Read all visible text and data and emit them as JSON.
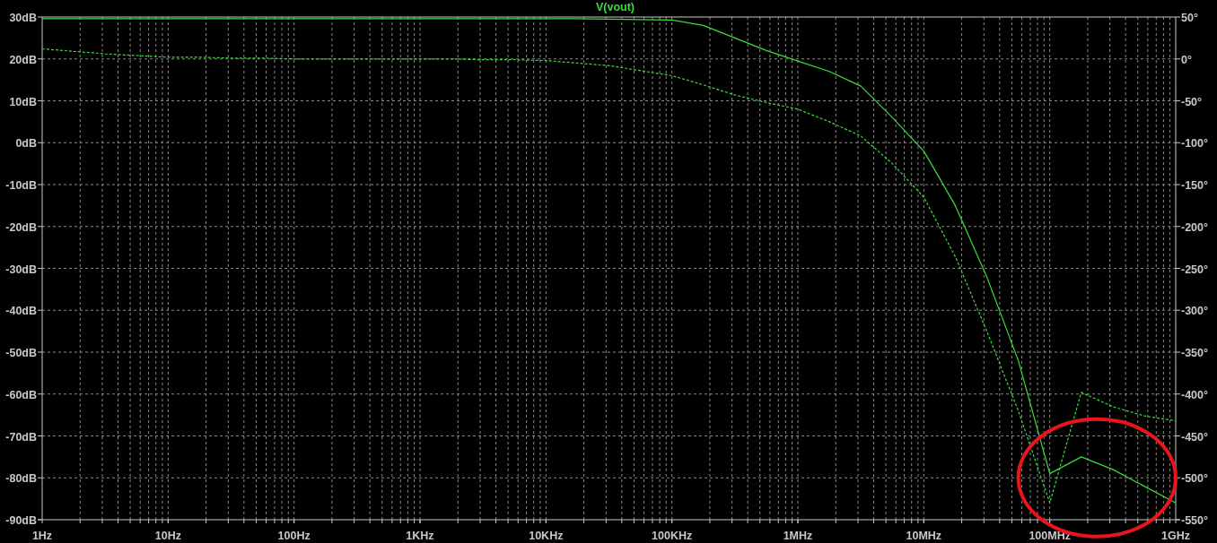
{
  "plot": {
    "chart_data": {
      "type": "line",
      "title": "V(vout)",
      "grid": true,
      "categories": [
        "1Hz",
        null,
        null,
        null,
        "10Hz",
        null,
        null,
        null,
        "100Hz",
        null,
        null,
        null,
        "1KHz",
        null,
        null,
        null,
        "10KHz",
        null,
        null,
        null,
        "100KHz",
        null,
        null,
        null,
        "1MHz",
        null,
        null,
        null,
        "10MHz",
        null,
        null,
        null,
        "100MHz",
        null,
        null,
        null,
        "1GHz"
      ],
      "series": [
        {
          "color": "#3cdc3c",
          "values": [
            29.6,
            29.6,
            29.6,
            29.6,
            29.6,
            29.6,
            29.6,
            29.6,
            29.6,
            29.6,
            29.6,
            29.6,
            29.6,
            29.6,
            29.6,
            29.6,
            29.6,
            29.6,
            29.5,
            29.4,
            29.3,
            28,
            25,
            22,
            19.5,
            17,
            13.5,
            6,
            -2,
            -15,
            -32,
            -52,
            -79,
            -75,
            -78,
            -82,
            -86
          ]
        },
        {
          "axis": "y2",
          "line_style": "dashed",
          "color": "#3cdc3c",
          "values": [
            12,
            9,
            6,
            4,
            2,
            2,
            1,
            1,
            0,
            0,
            0,
            0,
            0,
            0,
            -1,
            -1,
            -2,
            -5,
            -8,
            -14,
            -20,
            -31,
            -43,
            -52,
            -60,
            -75,
            -92,
            -125,
            -165,
            -236,
            -325,
            -420,
            -530,
            -398,
            -415,
            -426,
            -432
          ]
        }
      ],
      "ylim": [
        -90,
        30
      ],
      "y2lim": [
        -550,
        50
      ],
      "yticks": [
        {
          "value": 30,
          "label": "30dB"
        },
        {
          "value": 20,
          "label": "20dB"
        },
        {
          "value": 10,
          "label": "10dB"
        },
        {
          "value": 0,
          "label": "0dB"
        },
        {
          "value": -10,
          "label": "-10dB"
        },
        {
          "value": -20,
          "label": "-20dB"
        },
        {
          "value": -30,
          "label": "-30dB"
        },
        {
          "value": -40,
          "label": "-40dB"
        },
        {
          "value": -50,
          "label": "-50dB"
        },
        {
          "value": -60,
          "label": "-60dB"
        },
        {
          "value": -70,
          "label": "-70dB"
        },
        {
          "value": -80,
          "label": "-80dB"
        },
        {
          "value": -90,
          "label": "-90dB"
        }
      ],
      "y2ticks": [
        {
          "value": 50,
          "label": "50°"
        },
        {
          "value": 0,
          "label": "0°"
        },
        {
          "value": -50,
          "label": "-50°"
        },
        {
          "value": -100,
          "label": "-100°"
        },
        {
          "value": -150,
          "label": "-150°"
        },
        {
          "value": -200,
          "label": "-200°"
        },
        {
          "value": -250,
          "label": "-250°"
        },
        {
          "value": -300,
          "label": "-300°"
        },
        {
          "value": -350,
          "label": "-350°"
        },
        {
          "value": -400,
          "label": "-400°"
        },
        {
          "value": -450,
          "label": "-450°"
        },
        {
          "value": -500,
          "label": "-500°"
        },
        {
          "value": -550,
          "label": "-550°"
        }
      ]
    }
  }
}
